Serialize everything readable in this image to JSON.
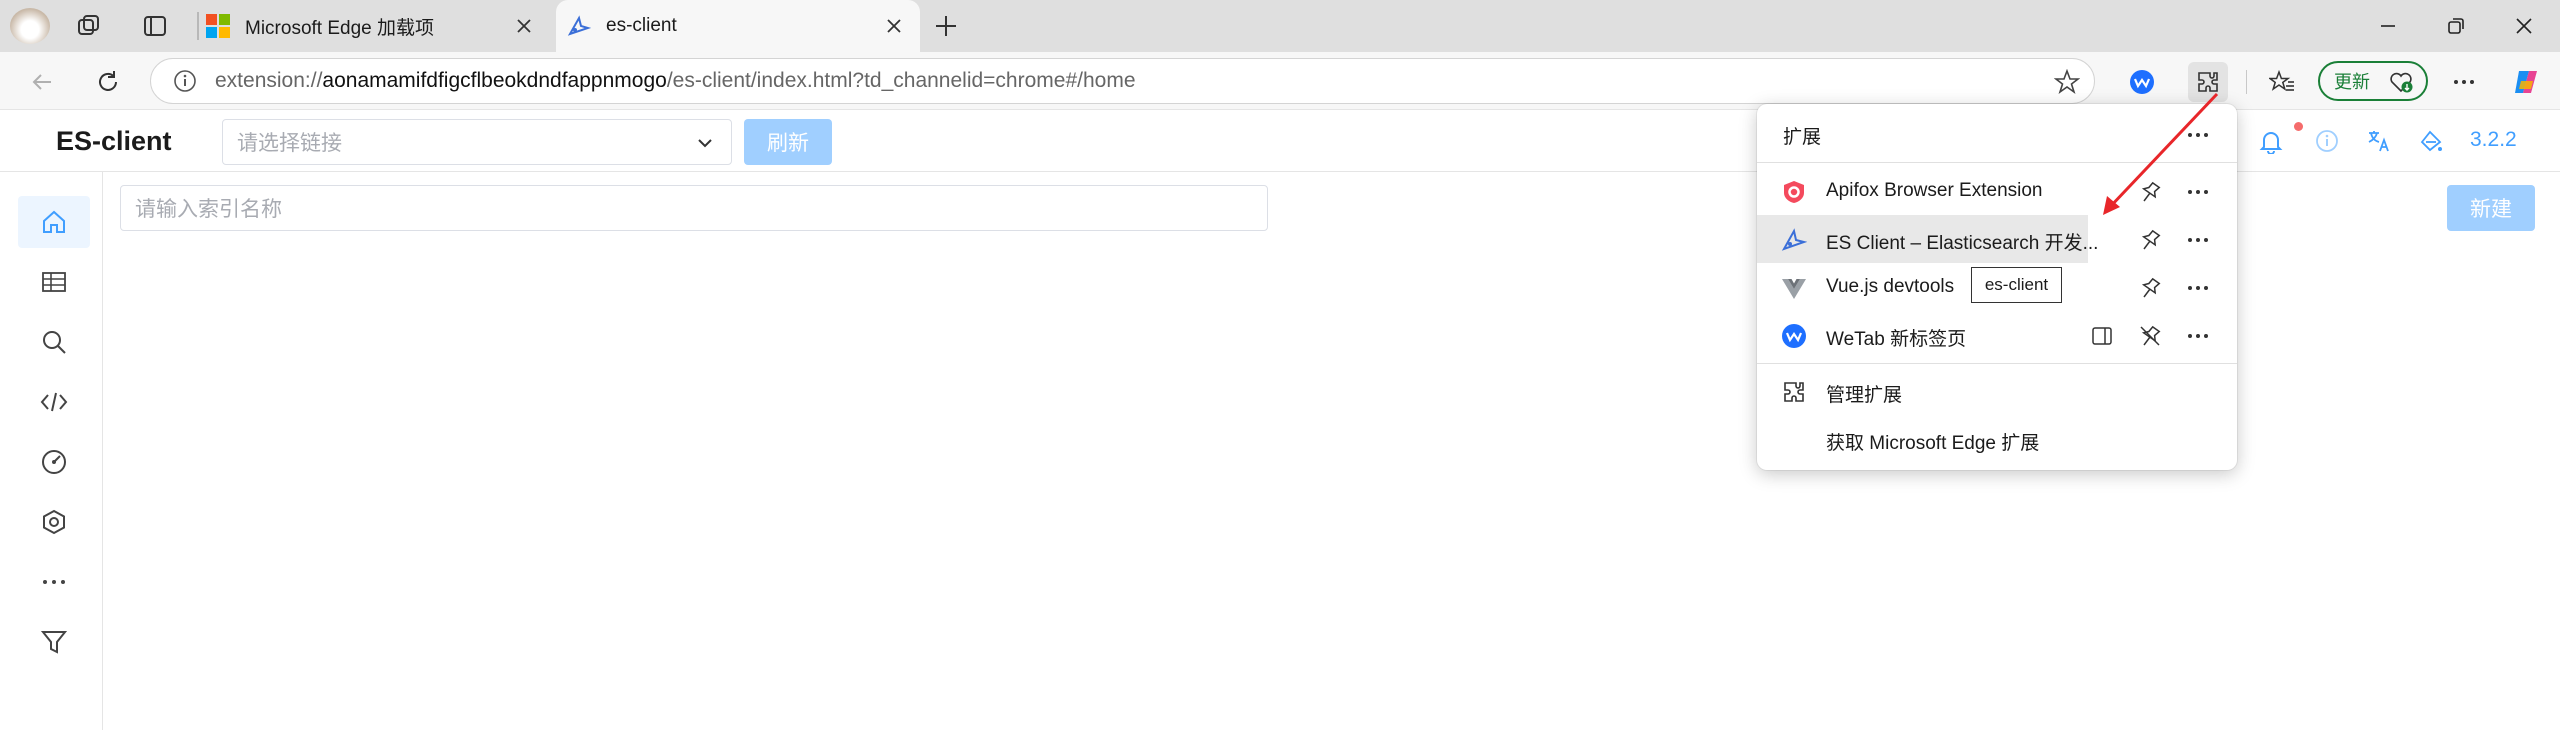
{
  "browser": {
    "tabs": [
      {
        "title": "Microsoft Edge 加载项"
      },
      {
        "title": "es-client"
      }
    ],
    "address": {
      "prefix": "extension://",
      "host": "aonamamifdfigcflbeokdndfappnmogo",
      "path": "/es-client/index.html?td_channelid=chrome#/home"
    },
    "update_label": "更新"
  },
  "app": {
    "brand": "ES-client",
    "connection_placeholder": "请选择链接",
    "refresh_label": "刷新",
    "index_search_placeholder": "请输入索引名称",
    "new_label": "新建",
    "version": "3.2.2"
  },
  "extensions_panel": {
    "title": "扩展",
    "items": [
      {
        "name": "Apifox Browser Extension",
        "icon": "apifox-icon"
      },
      {
        "name": "ES Client – Elasticsearch 开发...",
        "icon": "es-client-icon"
      },
      {
        "name": "Vue.js devtools",
        "icon": "vue-icon"
      },
      {
        "name": "WeTab 新标签页",
        "icon": "wetab-icon"
      }
    ],
    "manage_label": "管理扩展",
    "get_label": "获取 Microsoft Edge 扩展",
    "tooltip": "es-client"
  },
  "colors": {
    "accent": "#409eff",
    "disabled_button": "#a0cfff",
    "arrow": "#e8262a"
  }
}
